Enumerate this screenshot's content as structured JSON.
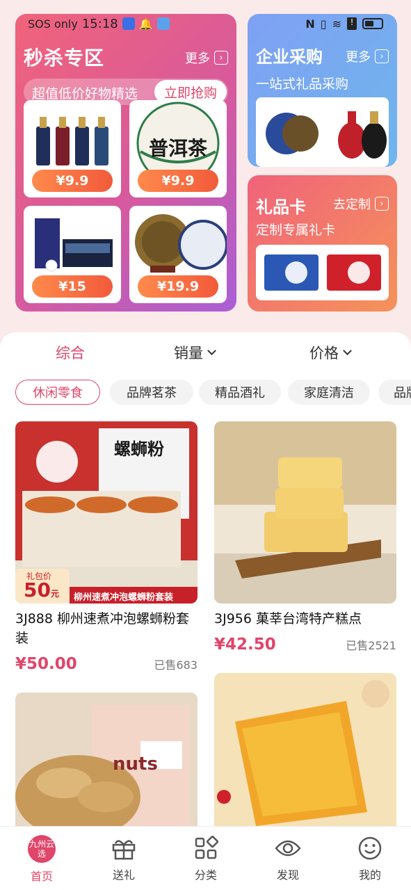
{
  "status_bar": {
    "sos": "SOS only",
    "time": "15:18"
  },
  "seckill": {
    "title": "秒杀专区",
    "more": "更多",
    "promo_text": "超值低价好物精选",
    "promo_button": "立即抢购",
    "tiles": [
      {
        "price": "¥9.9"
      },
      {
        "price": "¥9.9",
        "label": "普洱茶"
      },
      {
        "price": "¥15"
      },
      {
        "price": "¥19.9"
      }
    ]
  },
  "enterprise": {
    "title": "企业采购",
    "more": "更多",
    "subtitle": "一站式礼品采购"
  },
  "giftcard": {
    "title": "礼品卡",
    "more": "去定制",
    "subtitle": "定制专属礼卡"
  },
  "sort": {
    "comprehensive": "综合",
    "sales": "销量",
    "price": "价格"
  },
  "chips": [
    "休闲零食",
    "品牌茗茶",
    "精品酒礼",
    "家庭清洁",
    "品牌"
  ],
  "products": [
    {
      "name": "3J888 柳州速煮冲泡螺蛳粉套装",
      "price": "¥50.00",
      "sold": "已售683",
      "badge_label": "礼包价",
      "badge_price": "50",
      "badge_unit": "元",
      "banner": "柳州速煮冲泡螺蛳粉套装",
      "pack_text": "螺蛳粉"
    },
    {
      "name": "3J956 菓莘台湾特产糕点",
      "price": "¥42.50",
      "sold": "已售2521"
    },
    {
      "name": "",
      "price": "",
      "sold": "",
      "pack_text": "nuts"
    },
    {
      "name": "",
      "price": "",
      "sold": ""
    }
  ],
  "tabbar": [
    {
      "label": "首页",
      "icon": "home-logo-icon",
      "logo_text": "九州云选"
    },
    {
      "label": "送礼",
      "icon": "gift-icon"
    },
    {
      "label": "分类",
      "icon": "category-icon"
    },
    {
      "label": "发现",
      "icon": "eye-icon"
    },
    {
      "label": "我的",
      "icon": "smile-icon"
    }
  ],
  "colors": {
    "accent": "#e0456a",
    "price_pill": "#f25a3a"
  }
}
